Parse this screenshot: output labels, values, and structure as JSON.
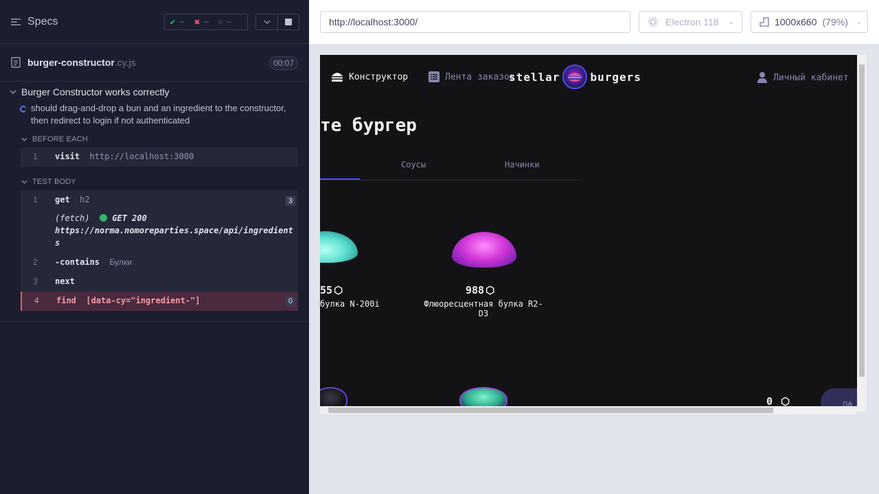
{
  "reporter": {
    "header": {
      "title": "Specs"
    },
    "stats": {
      "passed": "–",
      "failed": "–",
      "pending": "–"
    },
    "spec": {
      "name": "burger-constructor",
      "ext": ".cy.js",
      "duration": "00:07"
    },
    "suite": {
      "title": "Burger Constructor works correctly"
    },
    "test": {
      "title_line1": "should drag-and-drop a bun and an ingredient to the constructor,",
      "title_line2": "then redirect to login if not authenticated"
    },
    "before_each": {
      "label": "BEFORE EACH",
      "commands": [
        {
          "num": "1",
          "method": "visit",
          "arg": "http://localhost:3000"
        }
      ]
    },
    "test_body": {
      "label": "TEST BODY",
      "commands": [
        {
          "num": "1",
          "method": "get",
          "arg": "h2",
          "badge": "3"
        },
        {
          "num": "",
          "method": "(fetch)",
          "status": "GET 200",
          "url_line1": "https://norma.nomoreparties.space/api/ingredient",
          "url_line2": "s"
        },
        {
          "num": "2",
          "method": "-contains",
          "arg": "Булки"
        },
        {
          "num": "3",
          "method": "next",
          "arg": ""
        },
        {
          "num": "4",
          "method": "find",
          "arg": "[data-cy=\"ingredient-\"]",
          "badge": "0"
        }
      ]
    }
  },
  "aut": {
    "url": "http://localhost:3000/",
    "browser": "Electron 118",
    "viewport": "1000x660",
    "scale": "(79%)",
    "app": {
      "nav": {
        "constructor": "Конструктор",
        "feed": "Лента заказов",
        "profile": "Личный кабинет"
      },
      "logo": {
        "left": "stellar",
        "right": "burgers"
      },
      "heading": "те бургер",
      "tabs": {
        "sauces": "Соусы",
        "fillings": "Начинки"
      },
      "cards": [
        {
          "price": "55",
          "name": "булка N-200i"
        },
        {
          "price": "988",
          "name_line1": "Флюоресцентная булка R2-",
          "name_line2": "D3"
        }
      ],
      "order_btn": "Оф",
      "total": "0"
    }
  },
  "colors": {
    "accent": "#4c4cff",
    "passed": "#31b56e",
    "failed": "#e45770",
    "bg_dark": "#1b1e2e"
  }
}
